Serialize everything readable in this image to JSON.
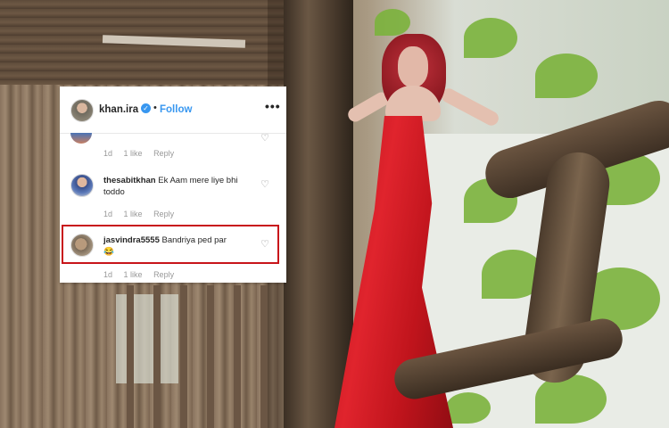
{
  "post": {
    "username": "khan.ira",
    "verified_symbol": "✓",
    "separator": "•",
    "follow_label": "Follow",
    "more_symbol": "•••"
  },
  "comments": [
    {
      "username": "",
      "text": "",
      "time": "1d",
      "likes": "1 like",
      "reply": "Reply"
    },
    {
      "username": "thesabitkhan",
      "text": "Ek Aam mere liye bhi toddo",
      "time": "1d",
      "likes": "1 like",
      "reply": "Reply"
    },
    {
      "username": "jasvindra5555",
      "text": "Bandriya ped par",
      "emoji": "😂",
      "time": "1d",
      "likes": "1 like",
      "reply": "Reply"
    }
  ],
  "icons": {
    "heart": "heart-icon",
    "more": "more-options-icon",
    "verified": "verified-badge-icon"
  },
  "colors": {
    "accent": "#3897f0",
    "highlight": "#c8141a",
    "dress": "#d11f28"
  }
}
